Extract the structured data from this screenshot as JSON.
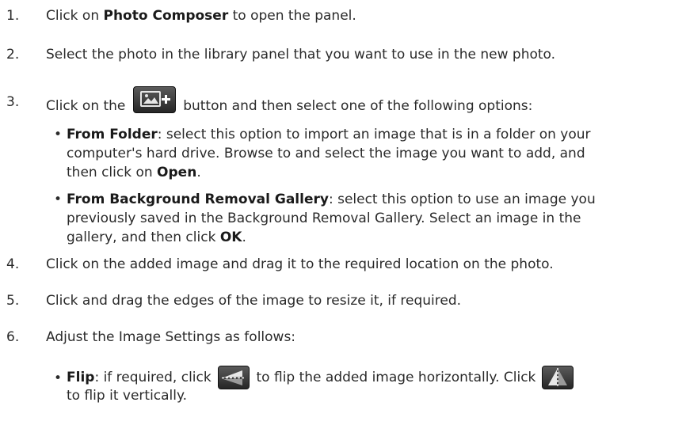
{
  "steps": [
    {
      "num": "1.",
      "pre": "Click on ",
      "bold": "Photo Composer",
      "post": " to open the panel."
    },
    {
      "num": "2.",
      "text": "Select the photo in the library panel that you want to use in the new photo."
    },
    {
      "num": "3.",
      "pre": "Click on the ",
      "post": " button and then select one of the following options:"
    },
    {
      "num": "4.",
      "text": "Click on the added image and drag it to the required location on the photo."
    },
    {
      "num": "5.",
      "text": "Click and drag the edges of the image to resize it, if required."
    },
    {
      "num": "6.",
      "text": "Adjust the Image Settings as follows:"
    }
  ],
  "bullets": [
    {
      "bold": "From Folder",
      "l1": ": select this option to import an image that is in a folder on your",
      "l2": "computer's hard drive. Browse to and select the image you want to add, and",
      "l3pre": "then click on ",
      "l3bold": "Open",
      "l3post": "."
    },
    {
      "bold": "From Background Removal Gallery",
      "l1": ": select this option to use an image you",
      "l2": "previously saved in the Background Removal Gallery. Select an image in the",
      "l3pre": "gallery, and then click ",
      "l3bold": "OK",
      "l3post": "."
    },
    {
      "bold": "Flip",
      "l1a": ": if required, click ",
      "l1b": " to flip the added image horizontally. Click ",
      "l2": "to flip it vertically."
    }
  ],
  "bullet_char": "•",
  "icons": [
    "add-image-icon",
    "flip-horizontal-icon",
    "flip-vertical-icon"
  ]
}
